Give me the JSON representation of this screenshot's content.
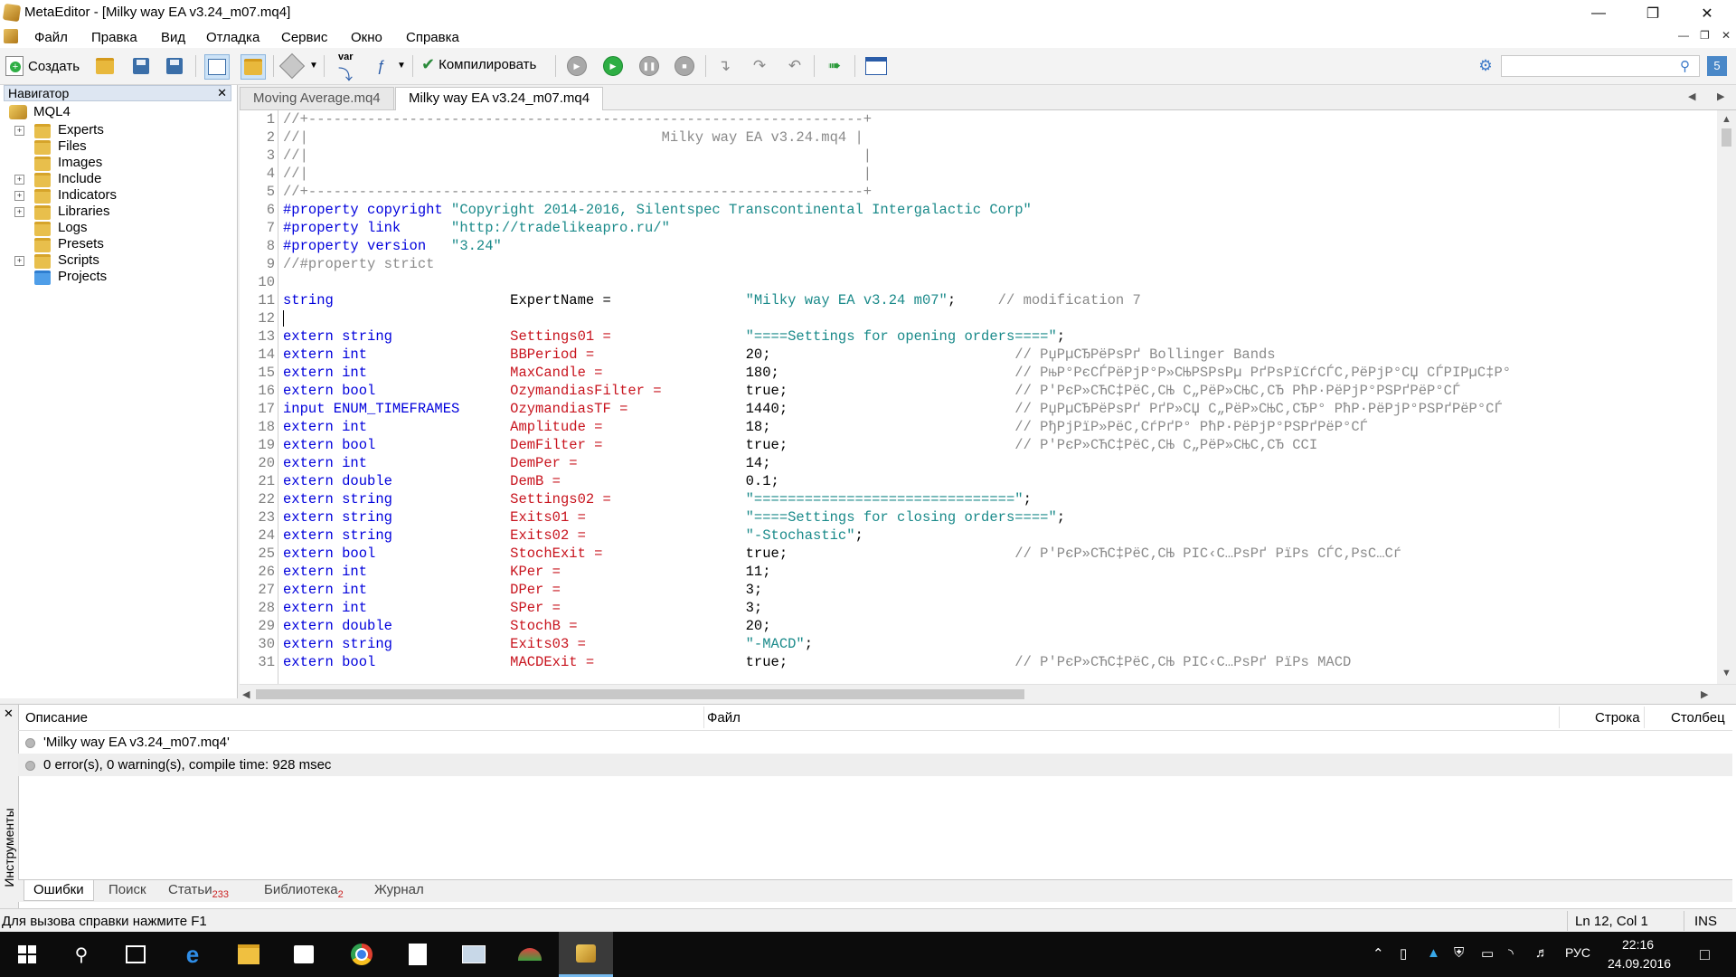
{
  "window": {
    "title": "MetaEditor - [Milky way EA v3.24_m07.mq4]"
  },
  "menu": [
    "Файл",
    "Правка",
    "Вид",
    "Отладка",
    "Сервис",
    "Окно",
    "Справка"
  ],
  "toolbar": {
    "create_label": "Создать",
    "compile_label": "Компилировать",
    "var_label": "var"
  },
  "navigator": {
    "title": "Навигатор",
    "root": "MQL4",
    "items": [
      {
        "label": "Experts",
        "expandable": true
      },
      {
        "label": "Files",
        "expandable": false
      },
      {
        "label": "Images",
        "expandable": false
      },
      {
        "label": "Include",
        "expandable": true
      },
      {
        "label": "Indicators",
        "expandable": true
      },
      {
        "label": "Libraries",
        "expandable": true
      },
      {
        "label": "Logs",
        "expandable": false
      },
      {
        "label": "Presets",
        "expandable": false
      },
      {
        "label": "Scripts",
        "expandable": true
      },
      {
        "label": "Projects",
        "expandable": false
      }
    ]
  },
  "tabs": [
    {
      "label": "Moving Average.mq4",
      "active": false
    },
    {
      "label": "Milky way EA v3.24_m07.mq4",
      "active": true
    }
  ],
  "code": [
    {
      "n": "1",
      "parts": [
        [
          "cm",
          "//+------------------------------------------------------------------+"
        ]
      ]
    },
    {
      "n": "2",
      "parts": [
        [
          "cm",
          "//|                                          Milky way EA v3.24.mq4 |"
        ]
      ]
    },
    {
      "n": "3",
      "parts": [
        [
          "cm",
          "//|                                                                  |"
        ]
      ]
    },
    {
      "n": "4",
      "parts": [
        [
          "cm",
          "//|                                                                  |"
        ]
      ]
    },
    {
      "n": "5",
      "parts": [
        [
          "cm",
          "//+------------------------------------------------------------------+"
        ]
      ]
    },
    {
      "n": "6",
      "parts": [
        [
          "kw",
          "#property copyright "
        ],
        [
          "str",
          "\"Copyright 2014-2016, Silentspec Transcontinental Intergalactic Corp\""
        ]
      ]
    },
    {
      "n": "7",
      "parts": [
        [
          "kw",
          "#property link      "
        ],
        [
          "str",
          "\"http://tradelikeapro.ru/\""
        ]
      ]
    },
    {
      "n": "8",
      "parts": [
        [
          "kw",
          "#property version   "
        ],
        [
          "str",
          "\"3.24\""
        ]
      ]
    },
    {
      "n": "9",
      "parts": [
        [
          "cm",
          "//#property strict"
        ]
      ]
    },
    {
      "n": "10",
      "parts": []
    },
    {
      "n": "11",
      "parts": [
        [
          "kw",
          "string                     "
        ],
        [
          "plain",
          "ExpertName =                "
        ],
        [
          "str",
          "\"Milky way EA v3.24 m07\""
        ],
        [
          "plain",
          ";     "
        ],
        [
          "mod",
          "// modification 7"
        ]
      ]
    },
    {
      "n": "12",
      "parts": []
    },
    {
      "n": "13",
      "parts": [
        [
          "kw",
          "extern string              "
        ],
        [
          "id",
          "Settings01 =                "
        ],
        [
          "str",
          "\"====Settings for opening orders====\""
        ],
        [
          "plain",
          ";"
        ]
      ]
    },
    {
      "n": "14",
      "parts": [
        [
          "kw",
          "extern int                 "
        ],
        [
          "id",
          "BBPeriod =                  "
        ],
        [
          "num",
          "20;                             "
        ],
        [
          "mod",
          "// РџРµСЂРёРѕРґ Bollinger Bands"
        ]
      ]
    },
    {
      "n": "15",
      "parts": [
        [
          "kw",
          "extern int                 "
        ],
        [
          "id",
          "MaxCandle =                 "
        ],
        [
          "num",
          "180;                            "
        ],
        [
          "mod",
          "// РњР°РєСЃРёРјР°Р»СЊРЅРѕРµ РґРѕРїСѓСЃС‚РёРјР°СЏ СЃРІРµС‡Р°"
        ]
      ]
    },
    {
      "n": "16",
      "parts": [
        [
          "kw",
          "extern bool                "
        ],
        [
          "id",
          "OzymandiasFilter =          "
        ],
        [
          "num",
          "true;                           "
        ],
        [
          "mod",
          "// Р'РєР»СЋС‡РёС‚СЊ С„РёР»СЊС‚СЂ РћР·РёРјР°РЅРґРёР°СЃ"
        ]
      ]
    },
    {
      "n": "17",
      "parts": [
        [
          "kw",
          "input ENUM_TIMEFRAMES      "
        ],
        [
          "id",
          "OzymandiasTF =              "
        ],
        [
          "num",
          "1440;                           "
        ],
        [
          "mod",
          "// РџРµСЂРёРѕРґ РґР»СЏ С„РёР»СЊС‚СЂР° РћР·РёРјР°РЅРґРёР°СЃ"
        ]
      ]
    },
    {
      "n": "18",
      "parts": [
        [
          "kw",
          "extern int                 "
        ],
        [
          "id",
          "Amplitude =                 "
        ],
        [
          "num",
          "18;                             "
        ],
        [
          "mod",
          "// РђРјРїР»РёС‚СѓРґР° РћР·РёРјР°РЅРґРёР°СЃ"
        ]
      ]
    },
    {
      "n": "19",
      "parts": [
        [
          "kw",
          "extern bool                "
        ],
        [
          "id",
          "DemFilter =                 "
        ],
        [
          "num",
          "true;                           "
        ],
        [
          "mod",
          "// Р'РєР»СЋС‡РёС‚СЊ С„РёР»СЊС‚СЂ CCI"
        ]
      ]
    },
    {
      "n": "20",
      "parts": [
        [
          "kw",
          "extern int                 "
        ],
        [
          "id",
          "DemPer =                    "
        ],
        [
          "num",
          "14;"
        ]
      ]
    },
    {
      "n": "21",
      "parts": [
        [
          "kw",
          "extern double              "
        ],
        [
          "id",
          "DemB =                      "
        ],
        [
          "num",
          "0.1;"
        ]
      ]
    },
    {
      "n": "22",
      "parts": [
        [
          "kw",
          "extern string              "
        ],
        [
          "id",
          "Settings02 =                "
        ],
        [
          "str",
          "\"===============================\""
        ],
        [
          "plain",
          ";"
        ]
      ]
    },
    {
      "n": "23",
      "parts": [
        [
          "kw",
          "extern string              "
        ],
        [
          "id",
          "Exits01 =                   "
        ],
        [
          "str",
          "\"====Settings for closing orders====\""
        ],
        [
          "plain",
          ";"
        ]
      ]
    },
    {
      "n": "24",
      "parts": [
        [
          "kw",
          "extern string              "
        ],
        [
          "id",
          "Exits02 =                   "
        ],
        [
          "str",
          "\"-Stochastic\""
        ],
        [
          "plain",
          ";"
        ]
      ]
    },
    {
      "n": "25",
      "parts": [
        [
          "kw",
          "extern bool                "
        ],
        [
          "id",
          "StochExit =                 "
        ],
        [
          "num",
          "true;                           "
        ],
        [
          "mod",
          "// Р'РєР»СЋС‡РёС‚СЊ РІС‹С…РѕРґ РїРѕ СЃС‚РѕС…Сѓ"
        ]
      ]
    },
    {
      "n": "26",
      "parts": [
        [
          "kw",
          "extern int                 "
        ],
        [
          "id",
          "KPer =                      "
        ],
        [
          "num",
          "11;"
        ]
      ]
    },
    {
      "n": "27",
      "parts": [
        [
          "kw",
          "extern int                 "
        ],
        [
          "id",
          "DPer =                      "
        ],
        [
          "num",
          "3;"
        ]
      ]
    },
    {
      "n": "28",
      "parts": [
        [
          "kw",
          "extern int                 "
        ],
        [
          "id",
          "SPer =                      "
        ],
        [
          "num",
          "3;"
        ]
      ]
    },
    {
      "n": "29",
      "parts": [
        [
          "kw",
          "extern double              "
        ],
        [
          "id",
          "StochB =                    "
        ],
        [
          "num",
          "20;"
        ]
      ]
    },
    {
      "n": "30",
      "parts": [
        [
          "kw",
          "extern string              "
        ],
        [
          "id",
          "Exits03 =                   "
        ],
        [
          "str",
          "\"-MACD\""
        ],
        [
          "plain",
          ";"
        ]
      ]
    },
    {
      "n": "31",
      "parts": [
        [
          "kw",
          "extern bool                "
        ],
        [
          "id",
          "MACDExit =                  "
        ],
        [
          "num",
          "true;                           "
        ],
        [
          "mod",
          "// Р'РєР»СЋС‡РёС‚СЊ РІС‹С…РѕРґ РїРѕ MACD"
        ]
      ]
    }
  ],
  "bottom_panel": {
    "headers": {
      "description": "Описание",
      "file": "Файл",
      "line": "Строка",
      "column": "Столбец"
    },
    "rows": [
      {
        "description": "'Milky way EA v3.24_m07.mq4'"
      },
      {
        "description": "0 error(s), 0 warning(s), compile time: 928 msec"
      }
    ],
    "side_label": "Инструменты",
    "tabs": [
      {
        "label": "Ошибки",
        "badge": ""
      },
      {
        "label": "Поиск",
        "badge": ""
      },
      {
        "label": "Статьи",
        "badge": "233"
      },
      {
        "label": "Библиотека",
        "badge": "2"
      },
      {
        "label": "Журнал",
        "badge": ""
      }
    ]
  },
  "status": {
    "help": "Для вызова справки нажмите F1",
    "position": "Ln 12, Col 1",
    "mode": "INS"
  },
  "taskbar": {
    "lang": "РУС",
    "time": "22:16",
    "date": "24.09.2016"
  }
}
